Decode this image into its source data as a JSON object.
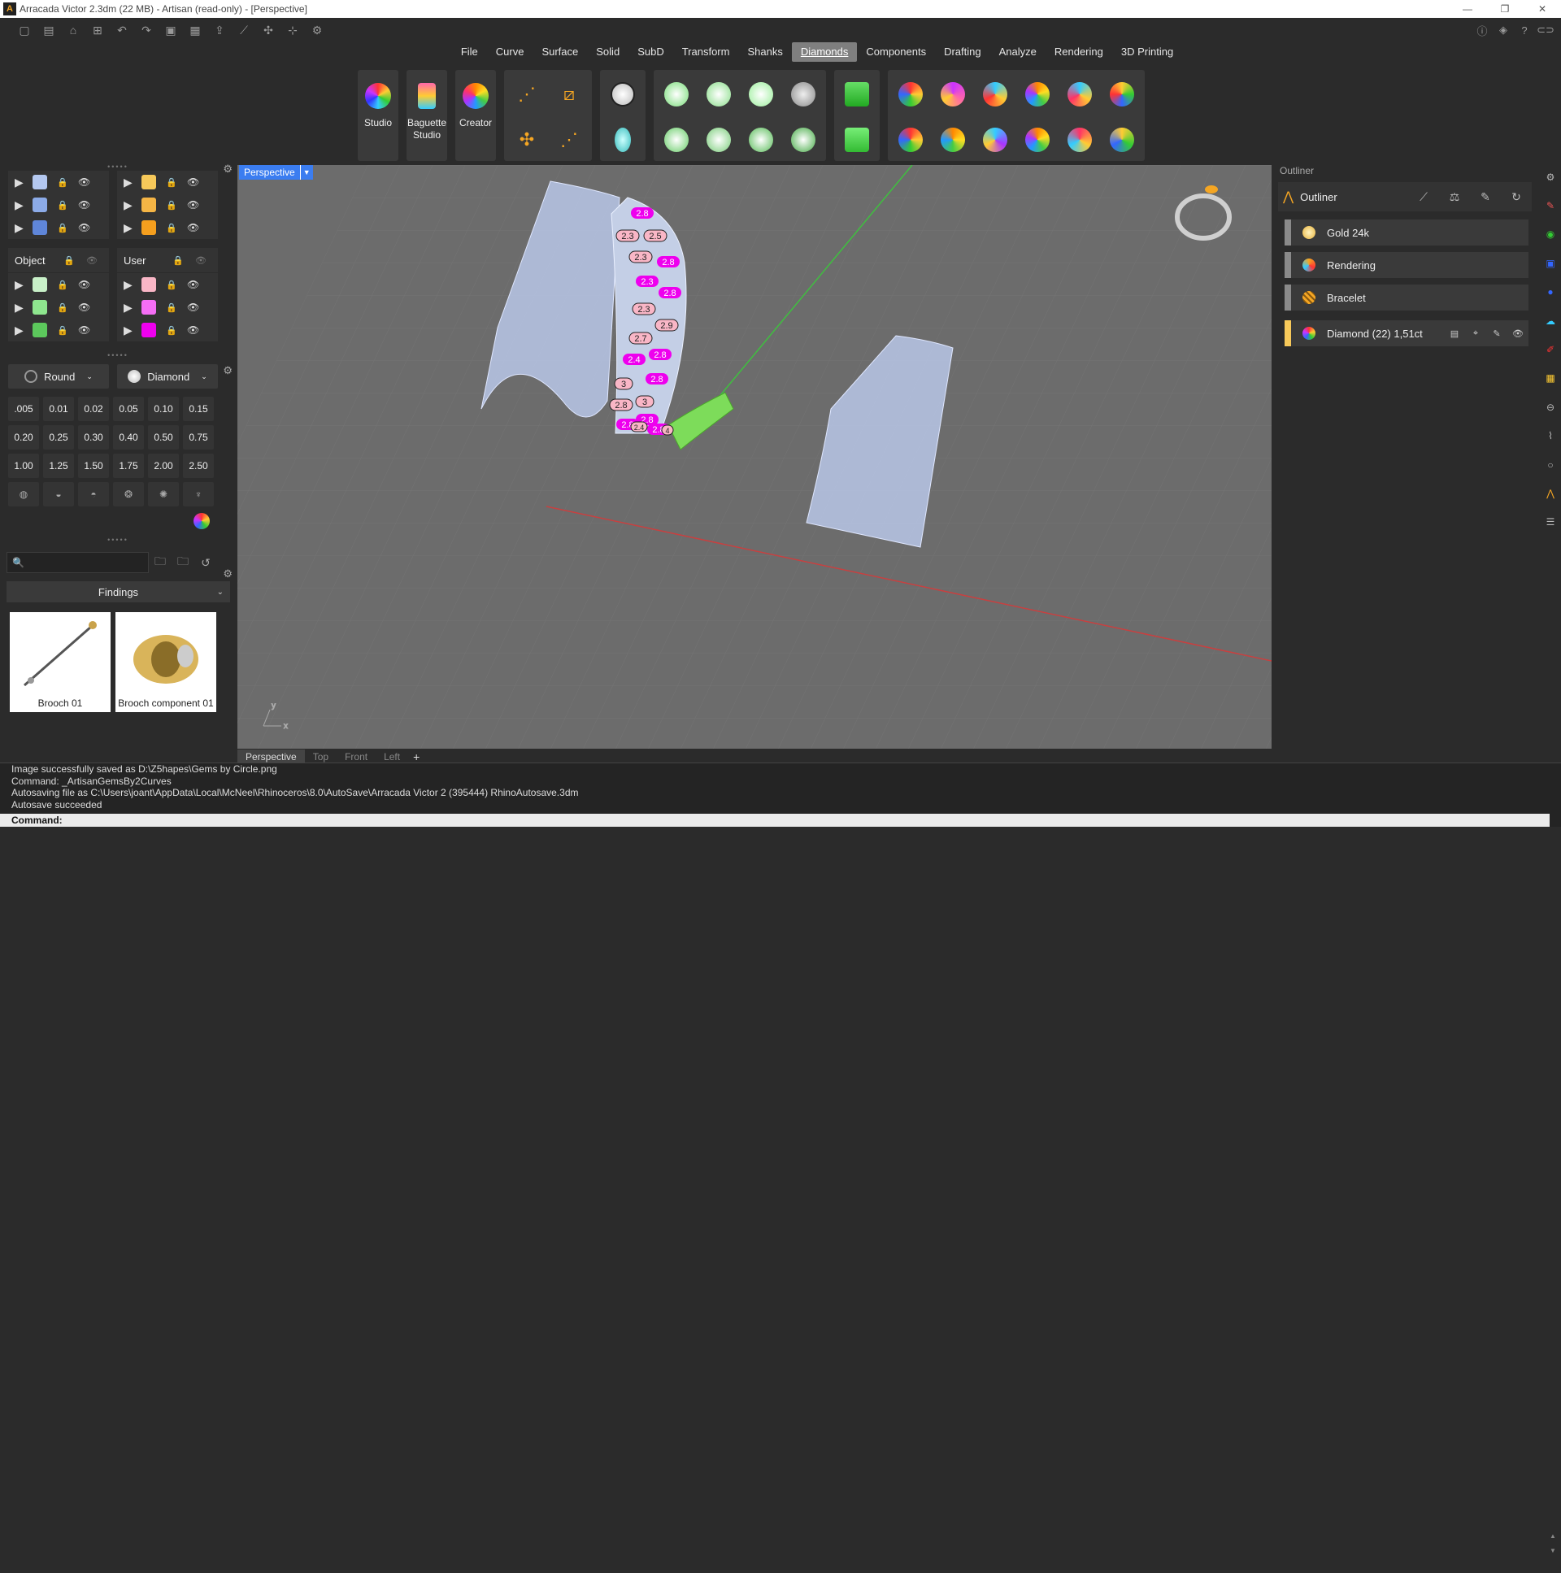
{
  "window": {
    "title": "Arracada Victor 2.3dm (22 MB) - Artisan (read-only) - [Perspective]",
    "controls": [
      "—",
      "❐",
      "✕"
    ]
  },
  "menu": [
    "File",
    "Curve",
    "Surface",
    "Solid",
    "SubD",
    "Transform",
    "Shanks",
    "Diamonds",
    "Components",
    "Drafting",
    "Analyze",
    "Rendering",
    "3D Printing"
  ],
  "active_menu": "Diamonds",
  "ribbon": {
    "big": [
      {
        "label": "Studio"
      },
      {
        "label": "Baguette Studio"
      },
      {
        "label": "Creator"
      }
    ]
  },
  "layers": {
    "object_label": "Object",
    "user_label": "User",
    "top_left_colors": [
      "#b4c8f0",
      "#8cabe8",
      "#5f86d9"
    ],
    "top_right_colors": [
      "#f7c95a",
      "#f5b545",
      "#f59f1e"
    ],
    "obj_colors": [
      "#c8f0c8",
      "#8ee68e",
      "#5cc85c"
    ],
    "user_colors": [
      "#f9b6c6",
      "#f56ef5",
      "#ee00ee"
    ]
  },
  "gem": {
    "shape": "Round",
    "material": "Diamond",
    "sizes": [
      ".005",
      "0.01",
      "0.02",
      "0.05",
      "0.10",
      "0.15",
      "0.20",
      "0.25",
      "0.30",
      "0.40",
      "0.50",
      "0.75",
      "1.00",
      "1.25",
      "1.50",
      "1.75",
      "2.00",
      "2.50"
    ]
  },
  "library": {
    "search_placeholder": "",
    "category": "Findings",
    "items": [
      "Brooch 01",
      "Brooch component 01"
    ]
  },
  "viewport": {
    "name": "Perspective",
    "tabs": [
      "Perspective",
      "Top",
      "Front",
      "Left"
    ],
    "gem_labels": [
      "2.8",
      "2.3",
      "2.5",
      "2.3",
      "2.8",
      "2.3",
      "2.8",
      "2.3",
      "2.9",
      "2.7",
      "2.4",
      "2.8",
      "3",
      "2.8",
      "2.8",
      "3",
      "2.8",
      "2.8",
      "2.8",
      "2.4",
      "4"
    ],
    "axis_x": "x",
    "axis_y": "y"
  },
  "outliner": {
    "panel_title": "Outliner",
    "title": "Outliner",
    "rows": [
      "Gold 24k",
      "Rendering",
      "Bracelet"
    ],
    "selection": "Diamond (22) 1,51ct"
  },
  "command": {
    "history": [
      "Image successfully saved as D:\\Z5hapes\\Gems by Circle.png",
      "Command: _ArtisanGemsBy2Curves",
      "Autosaving file as C:\\Users\\joant\\AppData\\Local\\McNeel\\Rhinoceros\\8.0\\AutoSave\\Arracada Victor 2 (395444) RhinoAutosave.3dm",
      "Autosave succeeded"
    ],
    "prompt": "Command:"
  }
}
